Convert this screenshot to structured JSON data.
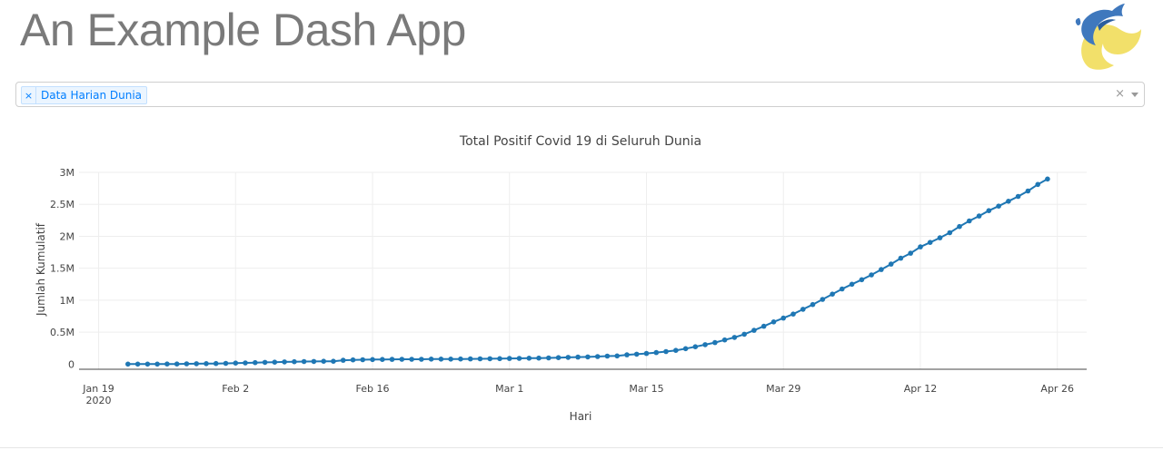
{
  "header": {
    "title": "An Example Dash App",
    "logo_icon": "dash-logo-icon"
  },
  "dropdown": {
    "selected": [
      "Data Harian Dunia"
    ],
    "remove_glyph": "×",
    "clear_glyph": "×"
  },
  "chart_data": {
    "type": "line",
    "mode": "lines+markers",
    "title": "Total Positif Covid 19 di Seluruh Dunia",
    "xlabel": "Hari",
    "ylabel": "Jumlah Kumulatif",
    "x_start": "2020-01-22",
    "x_end": "2020-04-25",
    "xlim": [
      "2020-01-17",
      "2020-04-29"
    ],
    "ylim": [
      -80000,
      3000000
    ],
    "x_ticks": [
      {
        "label": "Jan 19",
        "sub": "2020",
        "date": "2020-01-19"
      },
      {
        "label": "Feb 2",
        "date": "2020-02-02"
      },
      {
        "label": "Feb 16",
        "date": "2020-02-16"
      },
      {
        "label": "Mar 1",
        "date": "2020-03-01"
      },
      {
        "label": "Mar 15",
        "date": "2020-03-15"
      },
      {
        "label": "Mar 29",
        "date": "2020-03-29"
      },
      {
        "label": "Apr 12",
        "date": "2020-04-12"
      },
      {
        "label": "Apr 26",
        "date": "2020-04-26"
      }
    ],
    "y_ticks": [
      {
        "label": "0",
        "value": 0
      },
      {
        "label": "0.5M",
        "value": 500000
      },
      {
        "label": "1M",
        "value": 1000000
      },
      {
        "label": "1.5M",
        "value": 1500000
      },
      {
        "label": "2M",
        "value": 2000000
      },
      {
        "label": "2.5M",
        "value": 2500000
      },
      {
        "label": "3M",
        "value": 3000000
      }
    ],
    "grid": true,
    "legend": "none",
    "color": "#1f77b4",
    "series": [
      {
        "values": [
          555,
          654,
          941,
          1434,
          2118,
          2927,
          5578,
          6166,
          8234,
          9927,
          12038,
          16787,
          19881,
          23892,
          27635,
          30794,
          34391,
          37120,
          40150,
          42762,
          44802,
          45221,
          60368,
          66885,
          69030,
          71224,
          73258,
          75136,
          75639,
          76197,
          76819,
          78572,
          78958,
          79561,
          80406,
          81388,
          82746,
          84112,
          86011,
          88369,
          90306,
          92840,
          95120,
          97886,
          101801,
          105847,
          109821,
          113590,
          118620,
          125875,
          128352,
          145205,
          156101,
          167454,
          181574,
          197102,
          214821,
          242570,
          272208,
          304507,
          336953,
          378235,
          418045,
          467653,
          529591,
          593291,
          660706,
          720117,
          782365,
          857487,
          932605,
          1013466,
          1095917,
          1176060,
          1249754,
          1321481,
          1396476,
          1479804,
          1565278,
          1657526,
          1735650,
          1834721,
          1904838,
          1976191,
          2056054,
          2152437,
          2240190,
          2317759,
          2401379,
          2472259,
          2549123,
          2623960,
          2708885,
          2811193,
          2896636
        ]
      }
    ]
  }
}
